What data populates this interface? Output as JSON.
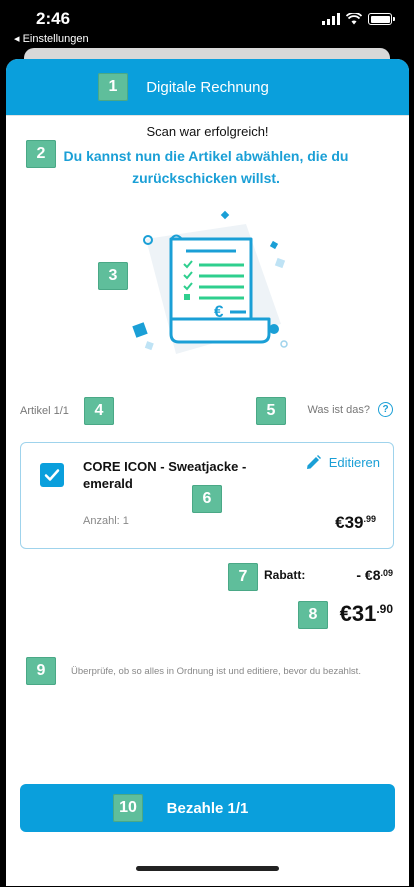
{
  "statusbar": {
    "time": "2:46",
    "back_label": "◂ Einstellungen"
  },
  "header": {
    "title": "Digitale Rechnung"
  },
  "scan": {
    "success": "Scan war erfolgreich!",
    "instruction": "Du kannst nun die Artikel abwählen, die du zurückschicken willst."
  },
  "articles": {
    "counter": "Artikel 1/1",
    "help_label": "Was ist das?",
    "help_glyph": "?"
  },
  "item": {
    "name": "CORE ICON - Sweatjacke - emerald",
    "edit_label": "Editieren",
    "quantity": "Anzahl: 1",
    "price_main": "€39",
    "price_cents": ".99",
    "checked": true
  },
  "summary": {
    "rabatt_label": "Rabatt:",
    "rabatt_main": "- €8",
    "rabatt_cents": ".09",
    "total_main": "€31",
    "total_cents": ".90"
  },
  "note": "Überprüfe, ob so alles in Ordnung ist und editiere, bevor du bezahlst.",
  "pay_button": {
    "label": "Bezahle 1/1"
  },
  "annotations": [
    "1",
    "2",
    "3",
    "4",
    "5",
    "6",
    "7",
    "8",
    "9",
    "10"
  ],
  "colors": {
    "accent": "#0a9fdc",
    "badge": "#5fbe9b",
    "illustration": "#1a9fd6",
    "illustration_green": "#2fcf8e"
  }
}
